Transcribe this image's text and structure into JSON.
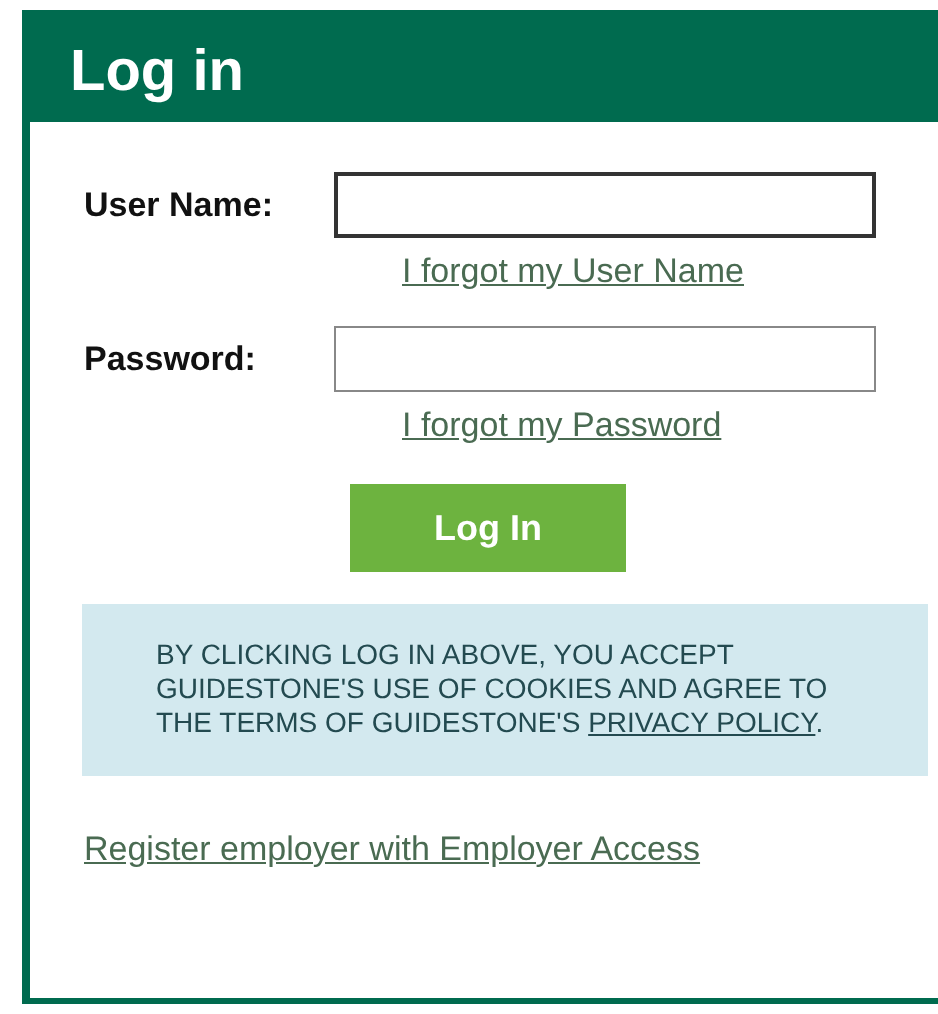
{
  "panel": {
    "title": "Log in"
  },
  "fields": [
    {
      "label": "User Name:",
      "focused": true,
      "link": "I forgot my User Name"
    },
    {
      "label": "Password:",
      "focused": false,
      "link": "I forgot my Password"
    }
  ],
  "submit": "Log In",
  "notice": {
    "text": "BY CLICKING LOG IN ABOVE, YOU ACCEPT GUIDESTONE'S USE OF COOKIES AND AGREE TO THE TERMS OF GUIDESTONE'S ",
    "link": "PRIVACY POLICY",
    "after": "."
  },
  "footer_link": "Register employer with Employer Access"
}
